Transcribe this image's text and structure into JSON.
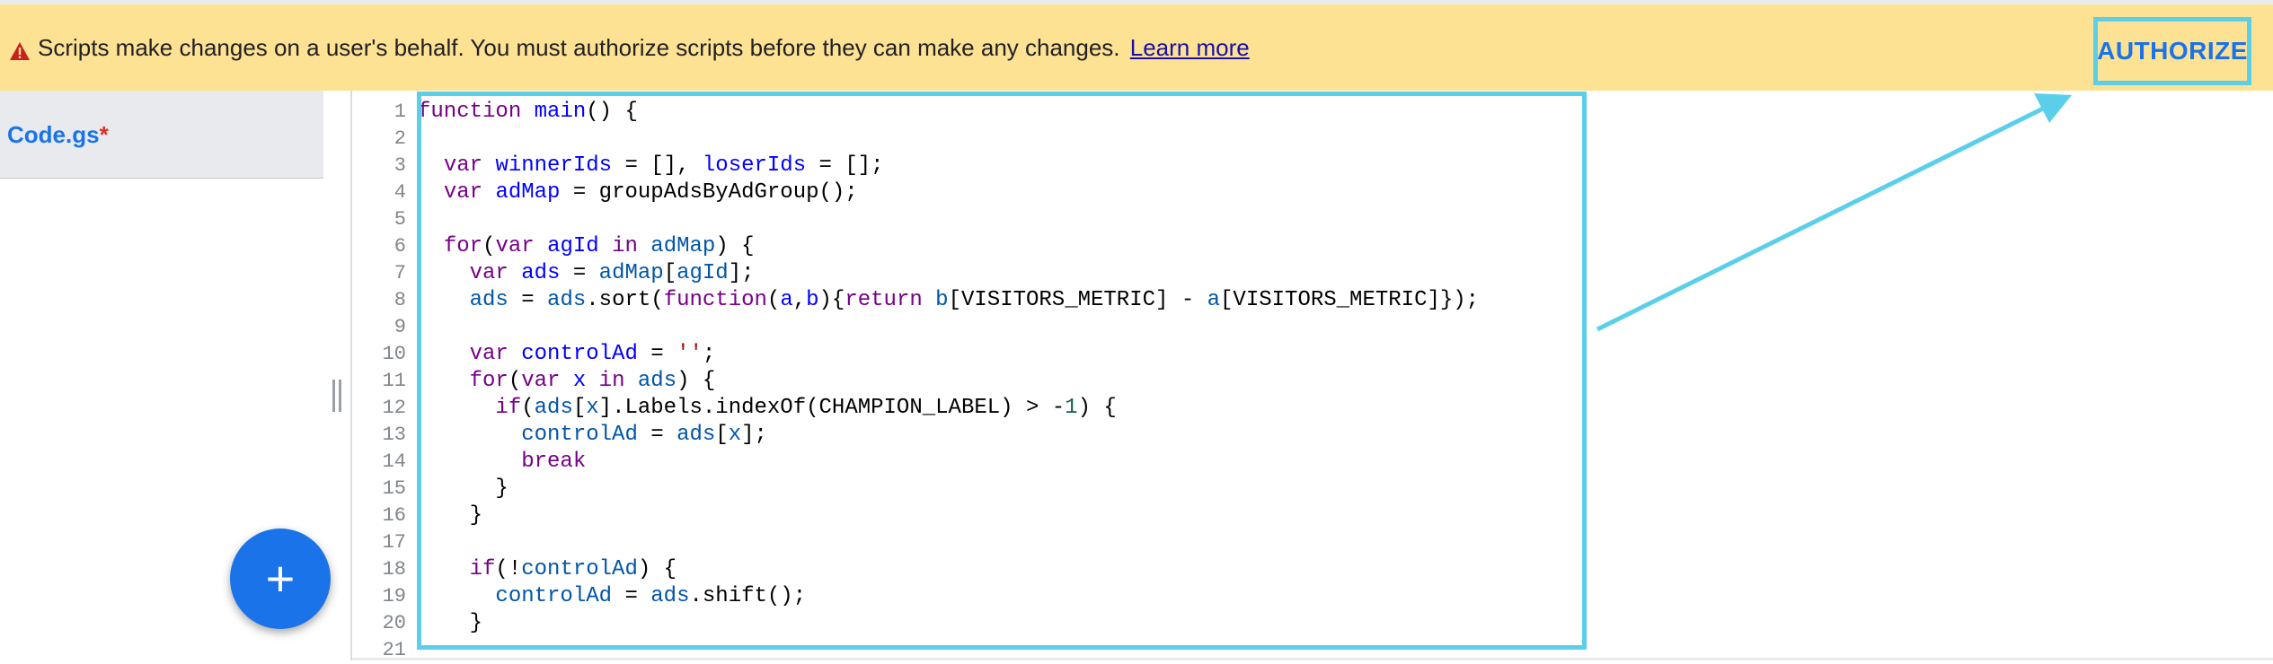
{
  "banner": {
    "message": "Scripts make changes on a user's behalf. You must authorize scripts before they can make any changes.",
    "link_label": "Learn more",
    "authorize_label": "AUTHORIZE",
    "icon": "warning-icon"
  },
  "sidebar": {
    "file_name": "Code.gs",
    "dirty_marker": "*",
    "add_button_label": "+"
  },
  "editor": {
    "line_numbers": [
      "1",
      "2",
      "3",
      "4",
      "5",
      "6",
      "7",
      "8",
      "9",
      "10",
      "11",
      "12",
      "13",
      "14",
      "15",
      "16",
      "17",
      "18",
      "19",
      "20",
      "21"
    ]
  },
  "colors": {
    "banner_bg": "#fde293",
    "accent": "#1a73e8",
    "annotation": "#5bcfea",
    "warning": "#d93025"
  }
}
